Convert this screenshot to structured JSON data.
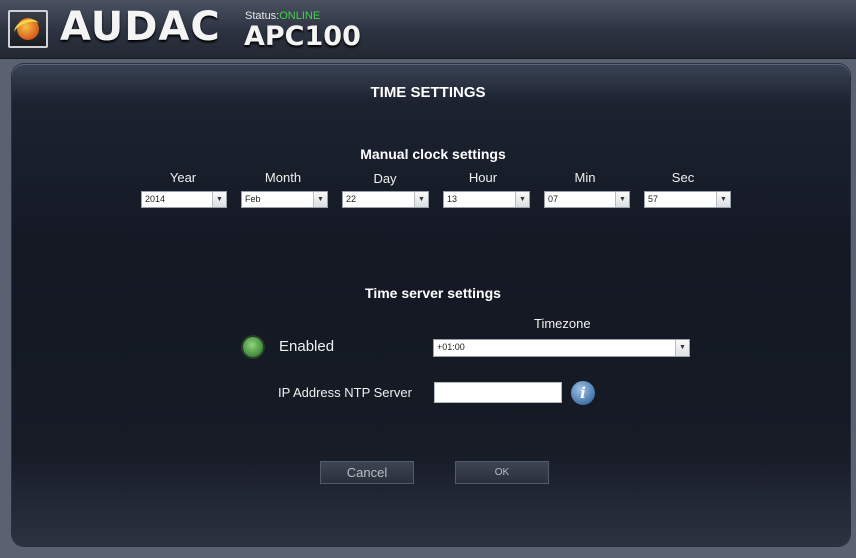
{
  "header": {
    "brand": "AUDAC",
    "status_label": "Status:",
    "status_value": "ONLINE",
    "model": "APC100"
  },
  "page": {
    "title": "TIME SETTINGS"
  },
  "manual": {
    "title": "Manual clock settings",
    "fields": [
      {
        "label": "Year",
        "value": "2014"
      },
      {
        "label": "Month",
        "value": "Feb"
      },
      {
        "label": "Day",
        "value": "22"
      },
      {
        "label": "Hour",
        "value": "13"
      },
      {
        "label": "Min",
        "value": "07"
      },
      {
        "label": "Sec",
        "value": "57"
      }
    ]
  },
  "server": {
    "title": "Time server settings",
    "enabled_label": "Enabled",
    "timezone_label": "Timezone",
    "timezone_value": "+01:00",
    "ntp_label": "IP Address NTP Server",
    "ntp_value": ""
  },
  "buttons": {
    "cancel": "Cancel",
    "ok": "OK"
  },
  "colors": {
    "online": "#46d24a",
    "background": "#131823"
  }
}
